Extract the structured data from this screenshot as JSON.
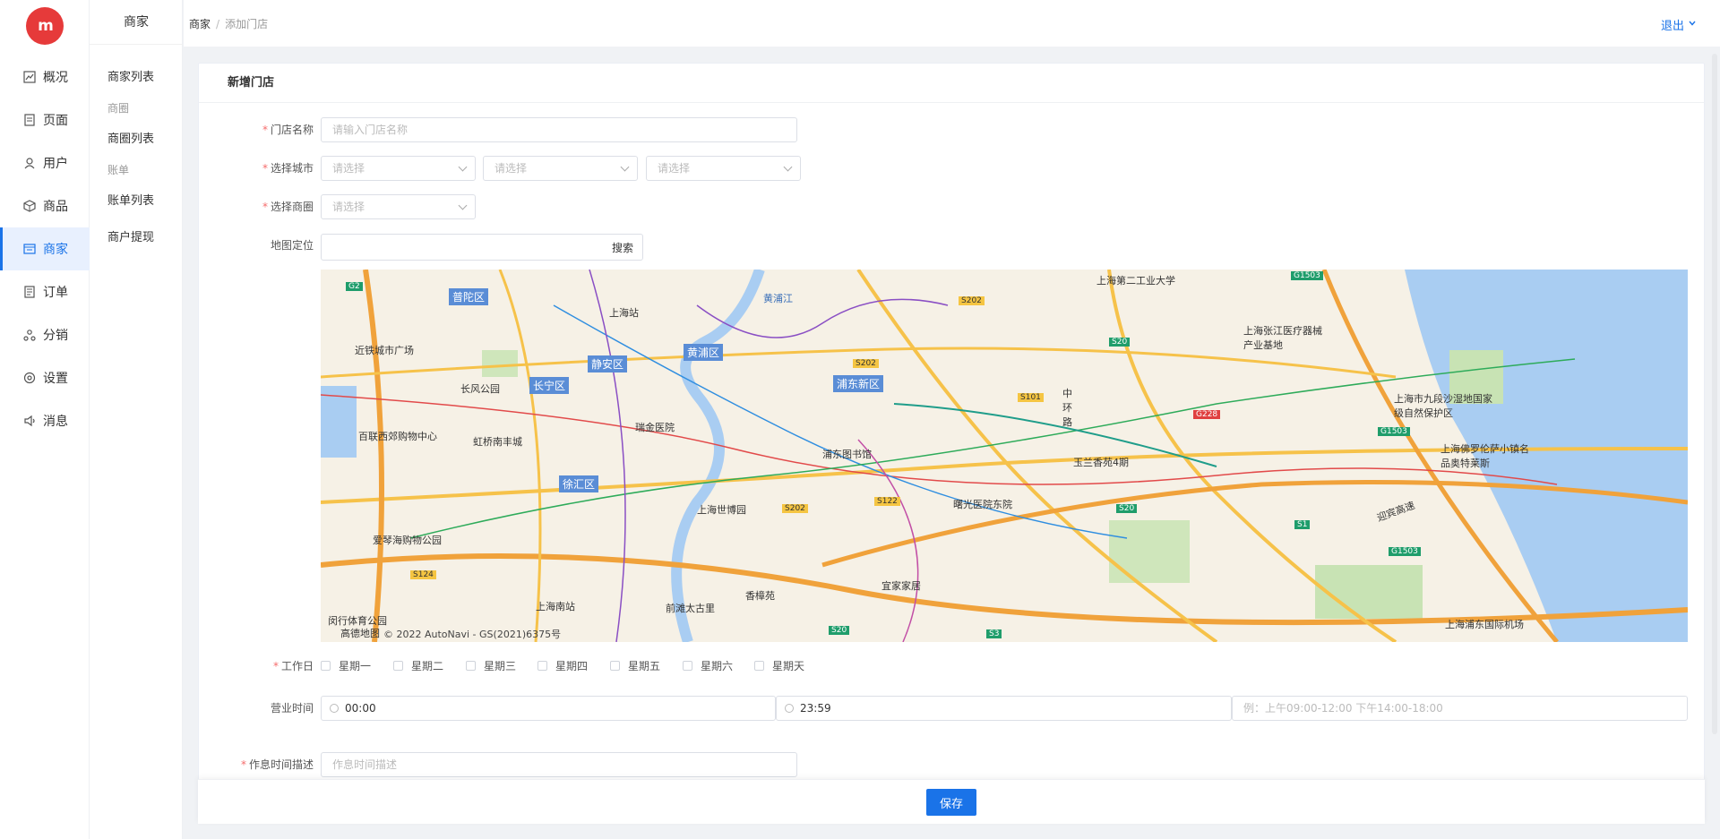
{
  "app": {
    "logo_text": "m"
  },
  "nav": {
    "items": [
      {
        "label": "概况",
        "icon": "chart-icon"
      },
      {
        "label": "页面",
        "icon": "page-icon"
      },
      {
        "label": "用户",
        "icon": "user-icon"
      },
      {
        "label": "商品",
        "icon": "box-icon"
      },
      {
        "label": "商家",
        "icon": "store-icon"
      },
      {
        "label": "订单",
        "icon": "order-icon"
      },
      {
        "label": "分销",
        "icon": "share-icon"
      },
      {
        "label": "设置",
        "icon": "gear-icon"
      },
      {
        "label": "消息",
        "icon": "speaker-icon"
      }
    ],
    "active": "商家"
  },
  "subnav": {
    "title": "商家",
    "merchant_list": "商家列表",
    "group_circle": "商圈",
    "circle_list": "商圈列表",
    "group_bill": "账单",
    "bill_list": "账单列表",
    "withdraw": "商户提现"
  },
  "header": {
    "breadcrumb": [
      "商家",
      "添加门店"
    ],
    "logout": "退出"
  },
  "form": {
    "title": "新增门店",
    "store_name": {
      "label": "门店名称",
      "placeholder": "请输入门店名称"
    },
    "city": {
      "label": "选择城市",
      "placeholders": [
        "请选择",
        "请选择",
        "请选择"
      ]
    },
    "circle": {
      "label": "选择商圈",
      "placeholder": "请选择"
    },
    "map": {
      "label": "地图定位",
      "search": "搜索"
    },
    "workday": {
      "label": "工作日",
      "days": [
        "星期一",
        "星期二",
        "星期三",
        "星期四",
        "星期五",
        "星期六",
        "星期天"
      ]
    },
    "hours": {
      "label": "营业时间",
      "start": "00:00",
      "end": "23:59",
      "placeholder": "例：上午09:00-12:00 下午14:00-18:00"
    },
    "desc": {
      "label": "作息时间描述",
      "placeholder": "作息时间描述"
    },
    "save": "保存"
  },
  "map_text": {
    "districts": [
      "普陀区",
      "静安区",
      "黄浦区",
      "长宁区",
      "徐汇区",
      "浦东新区"
    ],
    "places": [
      "上海站",
      "近铁城市广场",
      "长风公园",
      "百联西郊购物中心",
      "虹桥南丰城",
      "瑞金医院",
      "浦东图书馆",
      "上海世博园",
      "曙光医院东院",
      "玉兰香苑4期",
      "上海张江医疗器械产业基地",
      "上海市九段沙湿地国家级自然保护区",
      "上海佛罗伦萨小镇名品奥特莱斯",
      "上海第二工业大学",
      "宜家家居",
      "香樟苑",
      "前滩太古里",
      "上海南站",
      "爱琴海购物公园",
      "闵行体育公园",
      "上海浦东国际机场",
      "黄浦江",
      "中环路",
      "迎宾高速"
    ],
    "roads": [
      "G2",
      "S202",
      "S202",
      "S101",
      "S20",
      "S20",
      "G228",
      "G1503",
      "G1503",
      "S122",
      "S202",
      "S124",
      "S1",
      "S3",
      "S20",
      "G1503"
    ],
    "copyright": "© 2022 AutoNavi - GS(2021)6375号",
    "brand": "高德地图"
  }
}
